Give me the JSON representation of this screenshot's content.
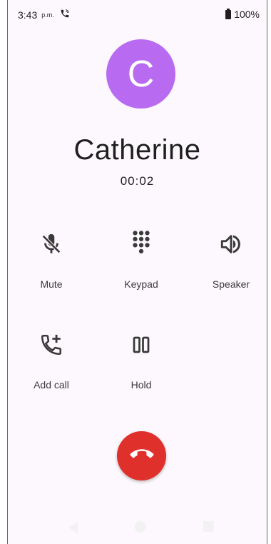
{
  "status_bar": {
    "time": "3:43",
    "ampm": "p.m.",
    "battery": "100%",
    "call_indicator_icon": "phone-in-call-icon"
  },
  "caller": {
    "initial": "C",
    "avatar_color": "#b86bf0",
    "name": "Catherine",
    "timer": "00:02"
  },
  "controls": {
    "mute": "Mute",
    "keypad": "Keypad",
    "speaker": "Speaker",
    "add_call": "Add call",
    "hold": "Hold"
  },
  "end_call": {
    "color": "#e0302b",
    "icon": "call-end-icon"
  },
  "nav": {
    "back_icon": "back-triangle-icon",
    "home_icon": "home-circle-icon",
    "recents_icon": "recents-square-icon"
  }
}
